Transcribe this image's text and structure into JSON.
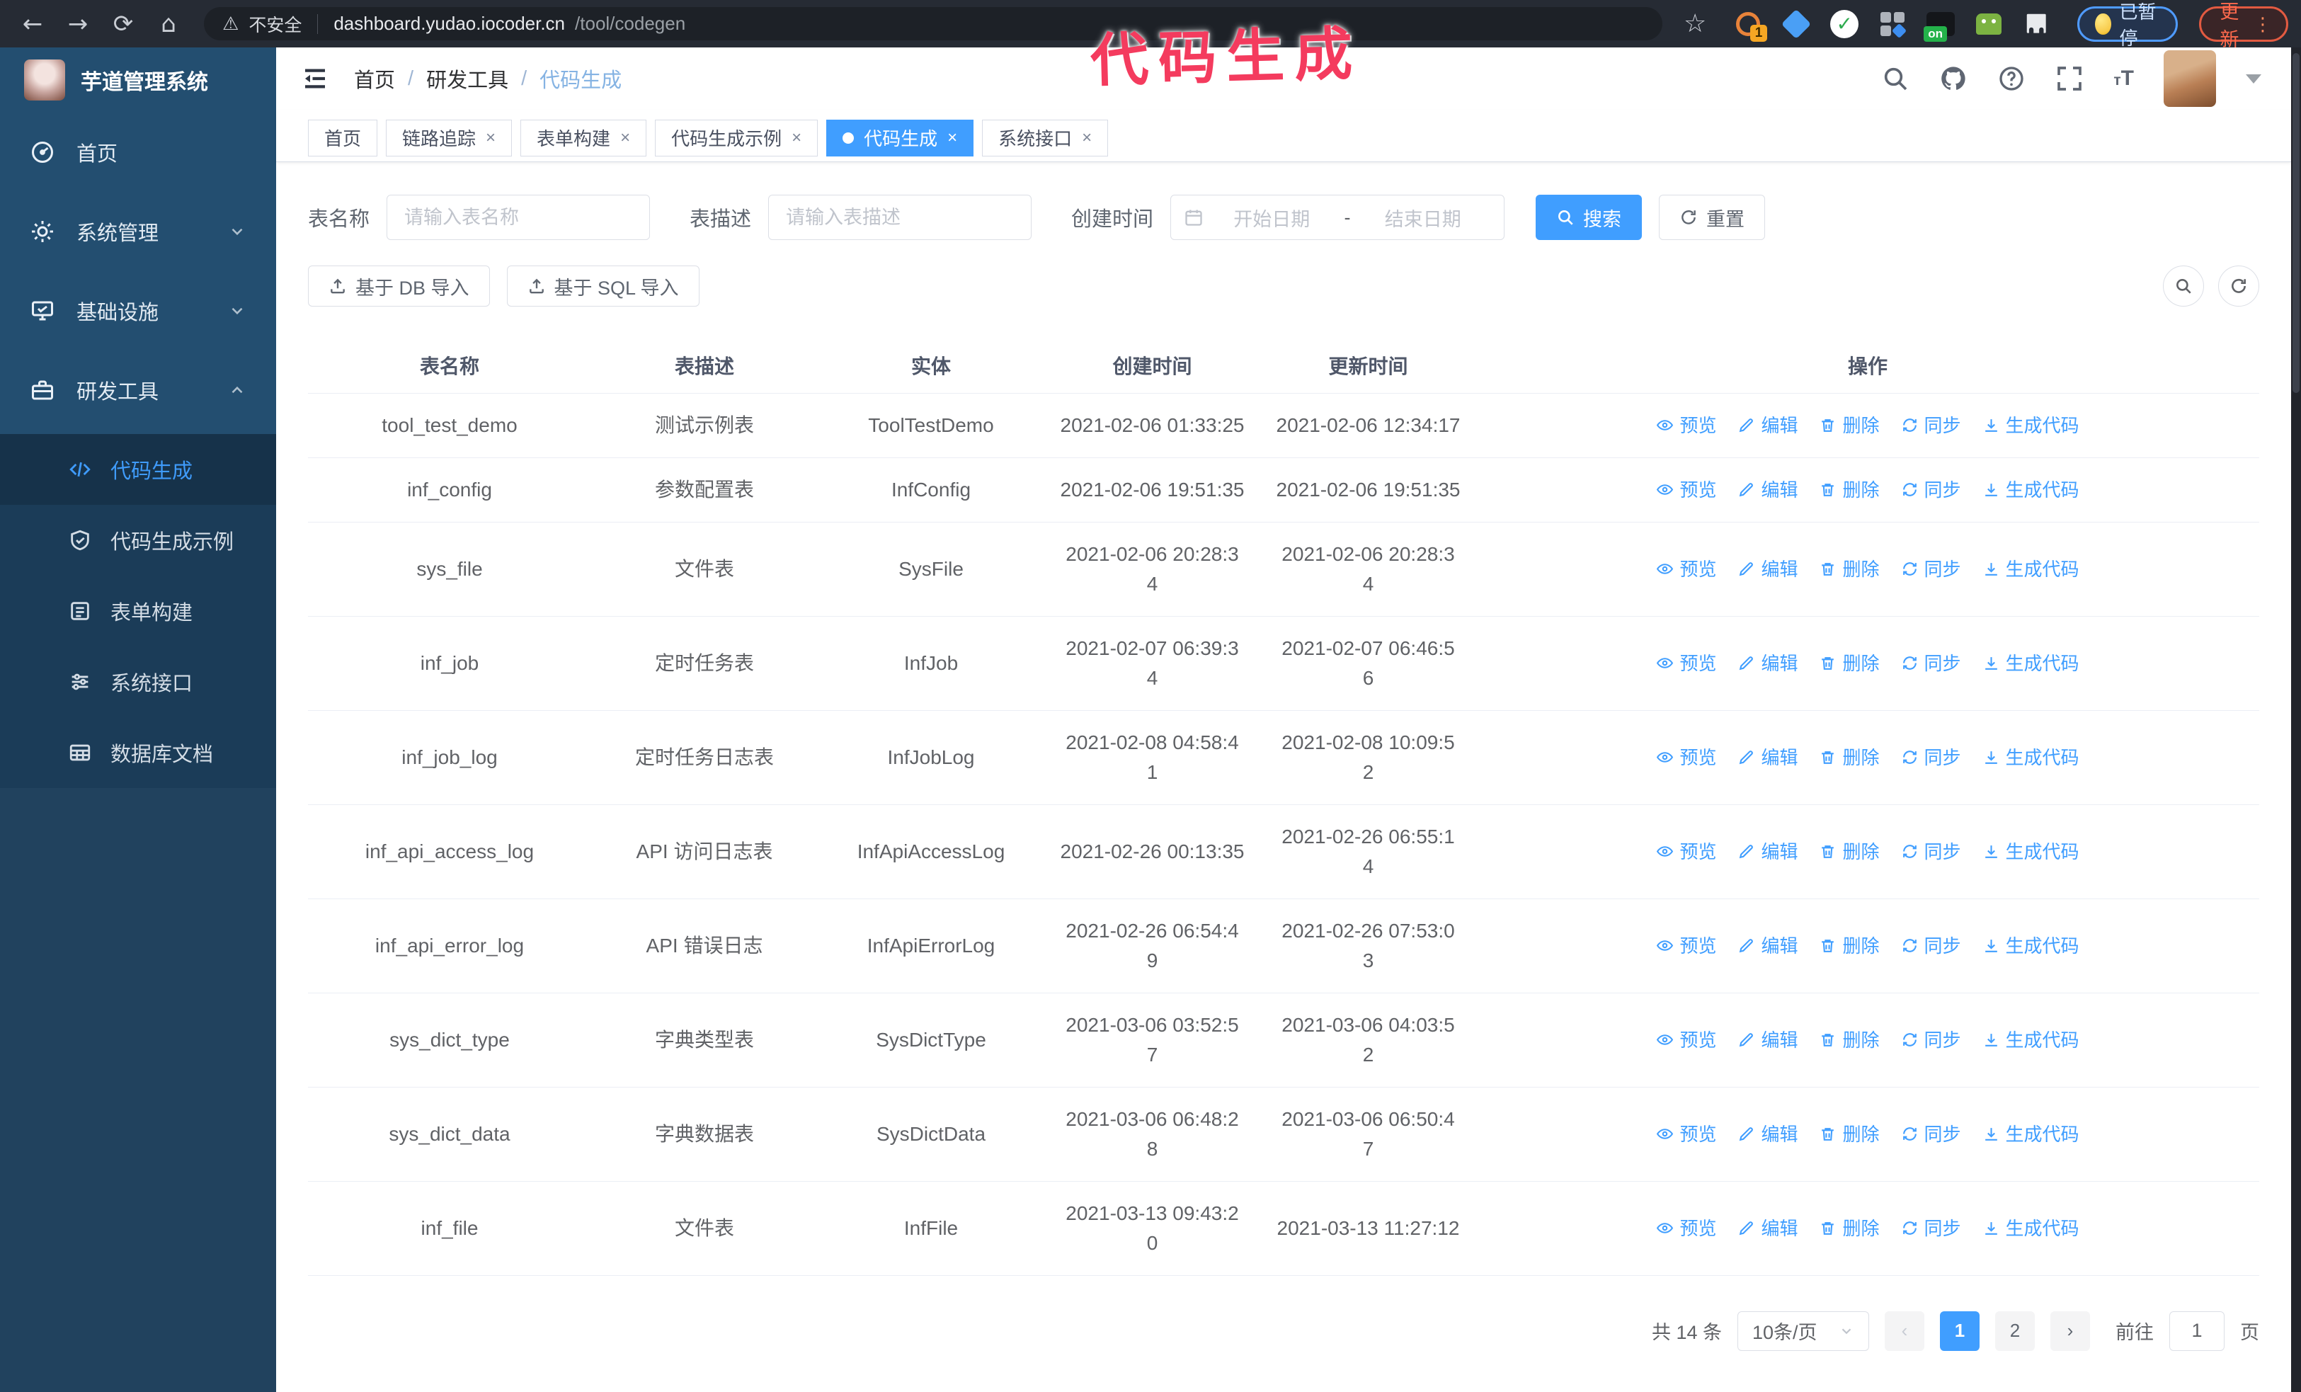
{
  "colors": {
    "accent": "#409eff",
    "watermark_pink": "#f43b5e",
    "sidebar_bg": "#234e70",
    "update_orange": "#ff6a4d",
    "paused_border_blue": "#4f9bff"
  },
  "watermark": "代码生成",
  "browser": {
    "security_label": "不安全",
    "url_host": "dashboard.yudao.iocoder.cn",
    "url_path": "/tool/codegen",
    "extension_badge": "1",
    "extension_on_badge": "on",
    "paused_badge": "已暂停",
    "update_button": "更新"
  },
  "sidebar": {
    "app_title": "芋道管理系统",
    "items": [
      {
        "label": "首页"
      },
      {
        "label": "系统管理"
      },
      {
        "label": "基础设施"
      },
      {
        "label": "研发工具"
      }
    ],
    "submenu": [
      {
        "label": "代码生成"
      },
      {
        "label": "代码生成示例"
      },
      {
        "label": "表单构建"
      },
      {
        "label": "系统接口"
      },
      {
        "label": "数据库文档"
      }
    ]
  },
  "header": {
    "breadcrumb": {
      "home": "首页",
      "group": "研发工具",
      "current": "代码生成"
    }
  },
  "tabs": [
    {
      "label": "首页"
    },
    {
      "label": "链路追踪"
    },
    {
      "label": "表单构建"
    },
    {
      "label": "代码生成示例"
    },
    {
      "label": "代码生成"
    },
    {
      "label": "系统接口"
    }
  ],
  "filters": {
    "table_name_label": "表名称",
    "table_name_placeholder": "请输入表名称",
    "table_desc_label": "表描述",
    "table_desc_placeholder": "请输入表描述",
    "create_time_label": "创建时间",
    "start_placeholder": "开始日期",
    "range_separator": "-",
    "end_placeholder": "结束日期",
    "search_label": "搜索",
    "reset_label": "重置"
  },
  "toolbar": {
    "import_db_label": "基于 DB 导入",
    "import_sql_label": "基于 SQL 导入"
  },
  "table": {
    "columns": [
      "表名称",
      "表描述",
      "实体",
      "创建时间",
      "更新时间",
      "操作"
    ],
    "actions": [
      "预览",
      "编辑",
      "删除",
      "同步",
      "生成代码"
    ],
    "rows": [
      {
        "name": "tool_test_demo",
        "desc": "测试示例表",
        "entity": "ToolTestDemo",
        "create_time": "2021-02-06 01:33:25",
        "update_time": "2021-02-06 12:34:17"
      },
      {
        "name": "inf_config",
        "desc": "参数配置表",
        "entity": "InfConfig",
        "create_time": "2021-02-06 19:51:35",
        "update_time": "2021-02-06 19:51:35"
      },
      {
        "name": "sys_file",
        "desc": "文件表",
        "entity": "SysFile",
        "create_time": "2021-02-06 20:28:3\n4",
        "update_time": "2021-02-06 20:28:3\n4"
      },
      {
        "name": "inf_job",
        "desc": "定时任务表",
        "entity": "InfJob",
        "create_time": "2021-02-07 06:39:3\n4",
        "update_time": "2021-02-07 06:46:5\n6"
      },
      {
        "name": "inf_job_log",
        "desc": "定时任务日志表",
        "entity": "InfJobLog",
        "create_time": "2021-02-08 04:58:4\n1",
        "update_time": "2021-02-08 10:09:5\n2"
      },
      {
        "name": "inf_api_access_log",
        "desc": "API 访问日志表",
        "entity": "InfApiAccessLog",
        "create_time": "2021-02-26 00:13:35",
        "update_time": "2021-02-26 06:55:1\n4"
      },
      {
        "name": "inf_api_error_log",
        "desc": "API 错误日志",
        "entity": "InfApiErrorLog",
        "create_time": "2021-02-26 06:54:4\n9",
        "update_time": "2021-02-26 07:53:0\n3"
      },
      {
        "name": "sys_dict_type",
        "desc": "字典类型表",
        "entity": "SysDictType",
        "create_time": "2021-03-06 03:52:5\n7",
        "update_time": "2021-03-06 04:03:5\n2"
      },
      {
        "name": "sys_dict_data",
        "desc": "字典数据表",
        "entity": "SysDictData",
        "create_time": "2021-03-06 06:48:2\n8",
        "update_time": "2021-03-06 06:50:4\n7"
      },
      {
        "name": "inf_file",
        "desc": "文件表",
        "entity": "InfFile",
        "create_time": "2021-03-13 09:43:2\n0",
        "update_time": "2021-03-13 11:27:12"
      }
    ]
  },
  "pagination": {
    "total": "共 14 条",
    "page_size": "10条/页",
    "prev": "‹",
    "pages": [
      "1",
      "2"
    ],
    "next": "›",
    "goto_label": "前往",
    "goto_value": "1",
    "page_suffix": "页"
  }
}
